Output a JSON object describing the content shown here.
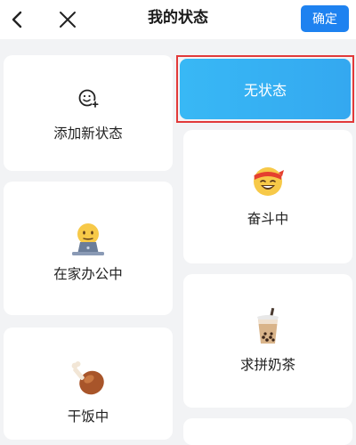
{
  "header": {
    "title": "我的状态",
    "confirm_label": "确定"
  },
  "statuses": {
    "add": "添加新状态",
    "none": "无状态",
    "working_hard": "奋斗中",
    "wfh": "在家办公中",
    "bubble_tea": "求拼奶茶",
    "eating": "干饭中"
  },
  "colors": {
    "accent": "#1e82f0",
    "selected_border": "#e23a3a",
    "none_card": "#38b8f5"
  }
}
